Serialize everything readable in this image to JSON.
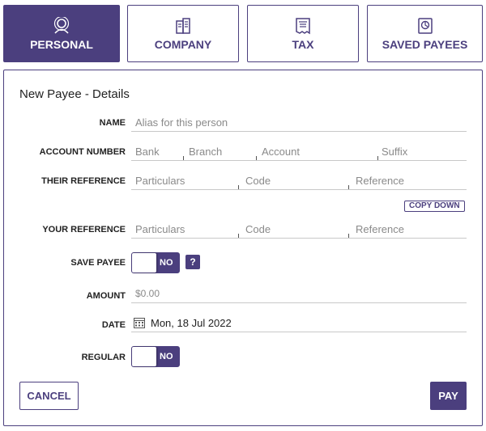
{
  "tabs": [
    {
      "label": "PERSONAL",
      "icon": "person-icon",
      "active": true
    },
    {
      "label": "COMPANY",
      "icon": "building-icon",
      "active": false
    },
    {
      "label": "TAX",
      "icon": "tax-icon",
      "active": false
    },
    {
      "label": "SAVED PAYEES",
      "icon": "saved-payees-icon",
      "active": false
    }
  ],
  "form": {
    "title": "New Payee - Details",
    "name": {
      "label": "NAME",
      "placeholder": "Alias for this person"
    },
    "account_number": {
      "label": "ACCOUNT NUMBER",
      "bank": "Bank",
      "branch": "Branch",
      "account": "Account",
      "suffix": "Suffix"
    },
    "their_reference": {
      "label": "THEIR REFERENCE",
      "particulars": "Particulars",
      "code": "Code",
      "reference": "Reference"
    },
    "copy_down": "COPY DOWN",
    "your_reference": {
      "label": "YOUR REFERENCE",
      "particulars": "Particulars",
      "code": "Code",
      "reference": "Reference"
    },
    "save_payee": {
      "label": "SAVE PAYEE",
      "toggle": "NO",
      "help": "?"
    },
    "amount": {
      "label": "AMOUNT",
      "placeholder": "$0.00"
    },
    "date": {
      "label": "DATE",
      "value": "Mon, 18 Jul 2022"
    },
    "regular": {
      "label": "REGULAR",
      "toggle": "NO"
    }
  },
  "actions": {
    "cancel": "CANCEL",
    "pay": "PAY"
  },
  "colors": {
    "accent": "#4b3f7e"
  }
}
